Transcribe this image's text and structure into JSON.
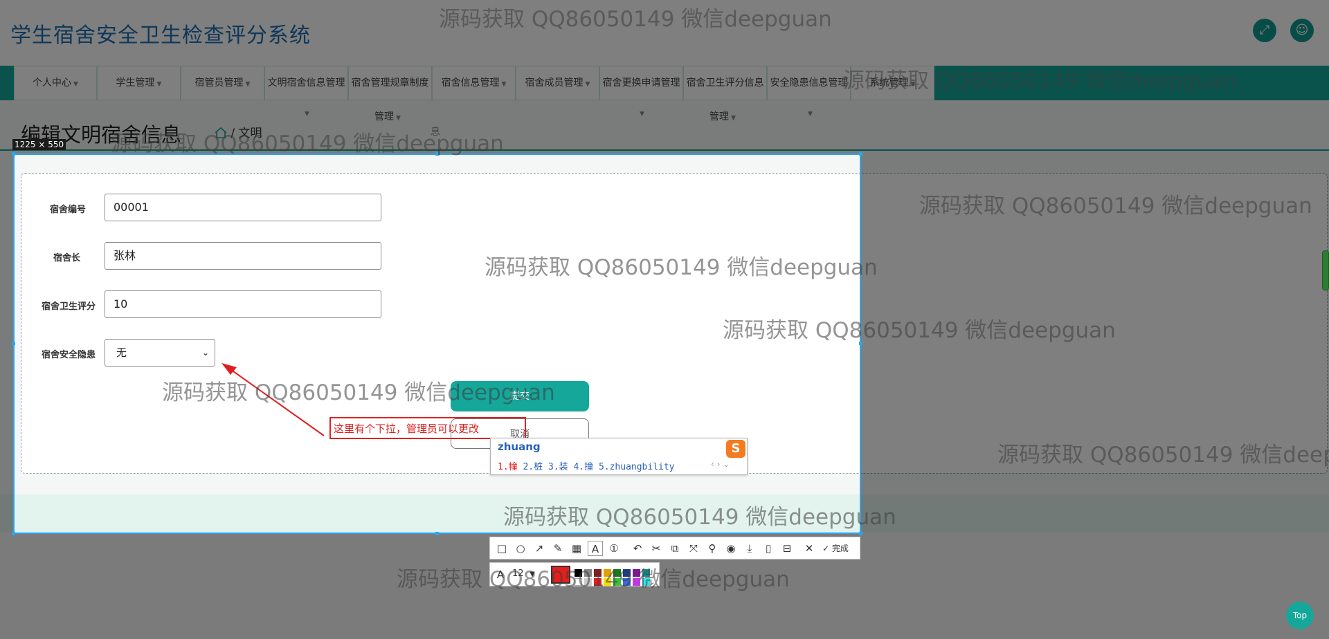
{
  "header": {
    "app_title": "学生宿舍安全卫生检查评分系统",
    "fullscreen_icon": "expand-icon",
    "user_icon": "user-icon"
  },
  "nav": {
    "items": [
      {
        "label": "个人中心"
      },
      {
        "label": "学生管理"
      },
      {
        "label": "宿管员管理"
      },
      {
        "label": "文明宿舍信息管理"
      },
      {
        "label": "宿舍管理规章制度",
        "sub": "管理"
      },
      {
        "label": "宿舍信息管理"
      },
      {
        "label": "宿舍成员管理"
      },
      {
        "label": "宿舍更换申请管理"
      },
      {
        "label": "宿舍卫生评分信息",
        "sub": "管理"
      },
      {
        "label": "安全隐患信息管理"
      },
      {
        "label": "系统管理"
      }
    ]
  },
  "page": {
    "title": "编辑文明宿舍信息",
    "breadcrumb_current": "/ 文明",
    "breadcrumb_tail": "息"
  },
  "form": {
    "fields": [
      {
        "label": "宿舍编号",
        "value": "00001"
      },
      {
        "label": "宿舍长",
        "value": "张林"
      },
      {
        "label": "宿舍卫生评分",
        "value": "10"
      }
    ],
    "select": {
      "label": "宿舍安全隐患",
      "value": "无"
    },
    "submit_label": "提交",
    "cancel_label": "取消"
  },
  "screenshot_tool": {
    "size_badge": "1225 × 550",
    "annotation_text": "这里有个下拉，管理员可以更改",
    "done_label": "完成",
    "font_size": "12"
  },
  "ime": {
    "pinyin": "zhuang",
    "candidates": [
      "1.幢",
      "2.桩",
      "3.装",
      "4.撞",
      "5.zhuangbility"
    ],
    "logo": "S"
  },
  "watermark": "源码获取 QQ86050149 微信deepguan",
  "back_to_top": "Top",
  "colors": {
    "brand": "#15a79a",
    "title": "#1f6fb0",
    "annotation": "#e02020",
    "selection": "#2aa6f0"
  }
}
